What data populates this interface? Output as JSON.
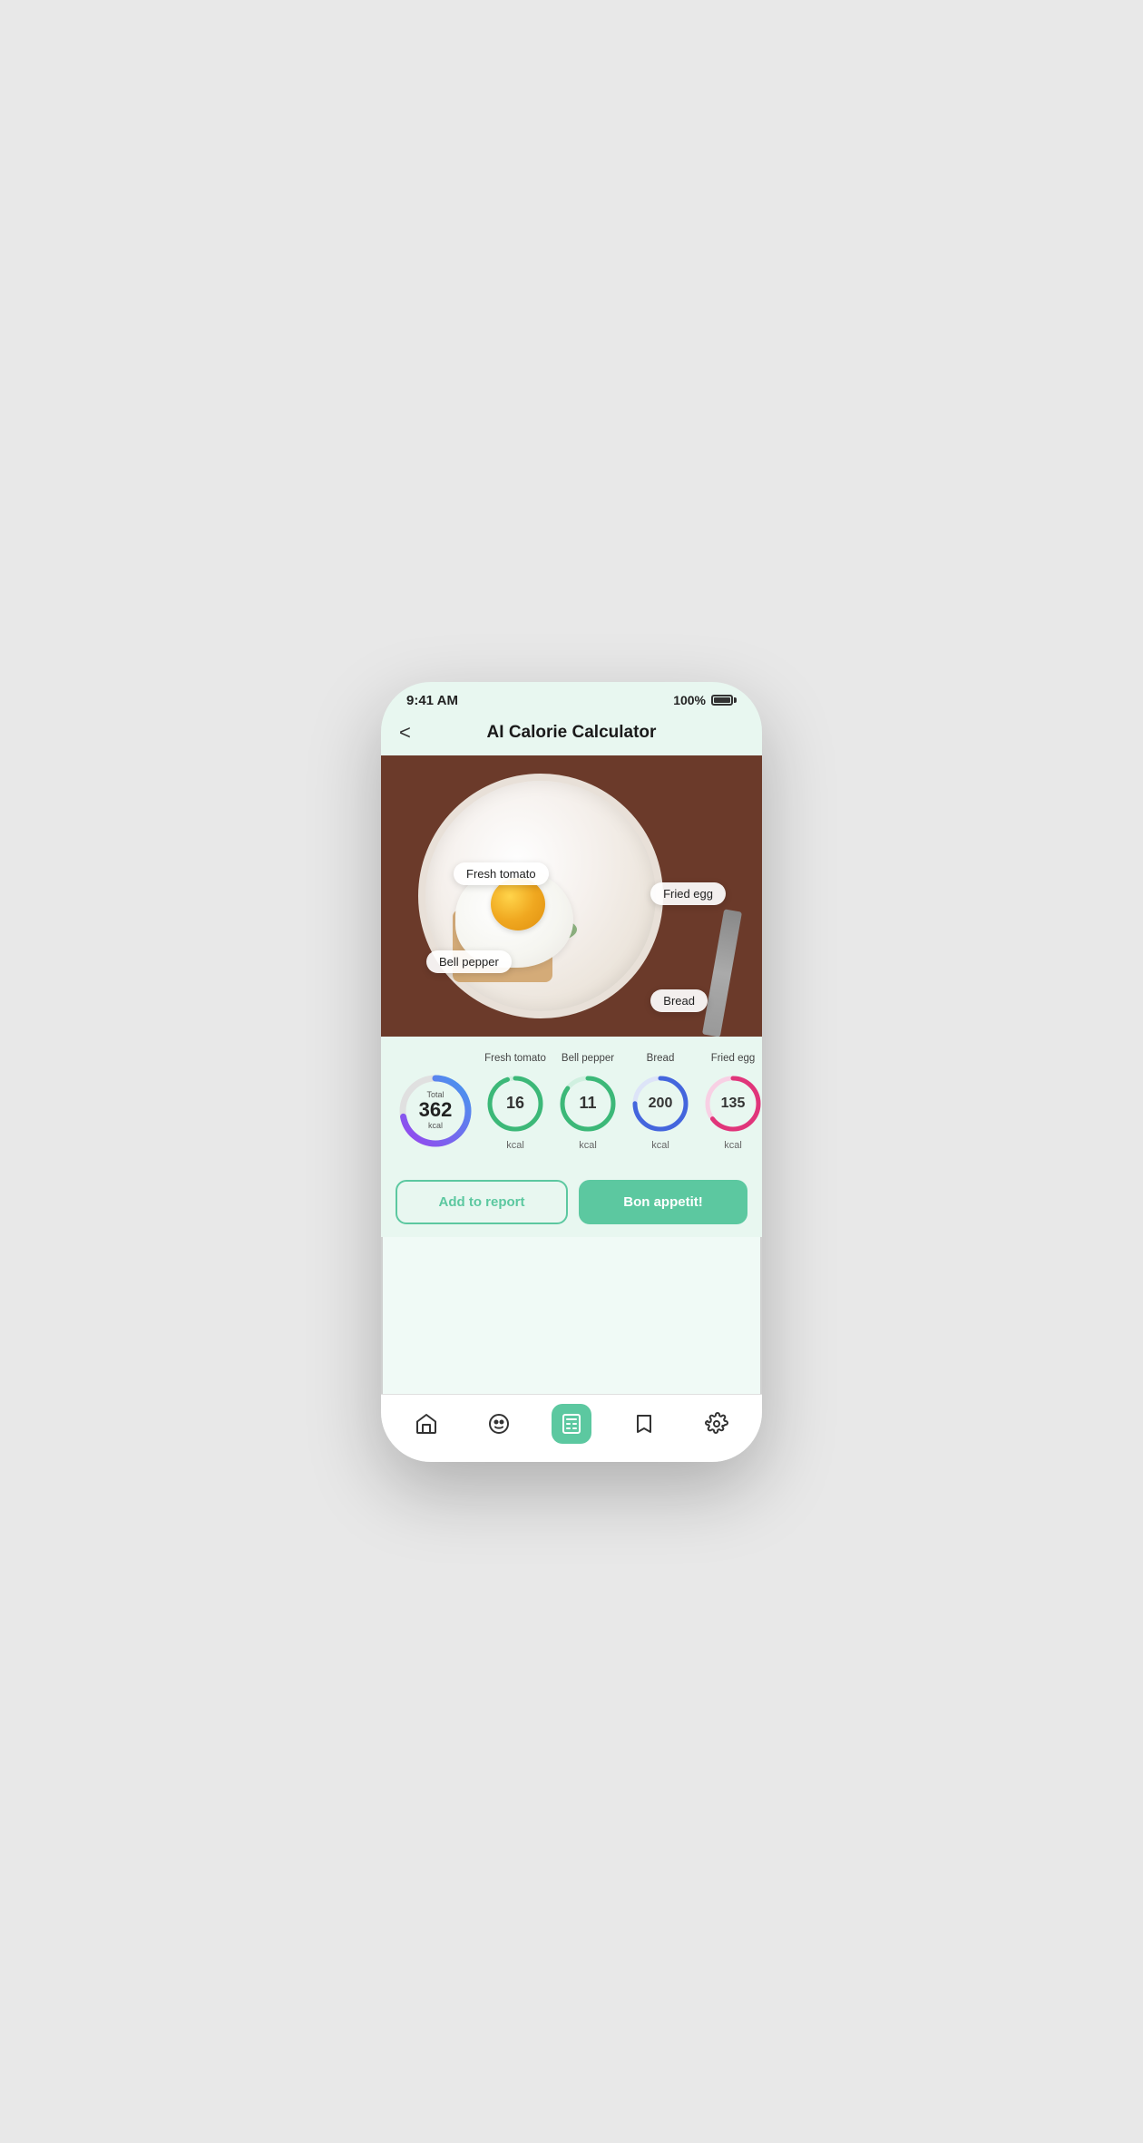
{
  "status": {
    "time": "9:41 AM",
    "battery": "100%"
  },
  "header": {
    "title": "AI Calorie Calculator",
    "back_label": "<"
  },
  "food_labels": {
    "fresh_tomato": "Fresh tomato",
    "fried_egg": "Fried egg",
    "bell_pepper": "Bell pepper",
    "bread": "Bread"
  },
  "calories": {
    "total_label": "Total",
    "total_value": "362",
    "total_unit": "kcal",
    "items": [
      {
        "name": "Fresh tomato",
        "value": "16",
        "unit": "kcal",
        "color": "#3cb878",
        "pct": 0.95,
        "track": "#d0f0e0"
      },
      {
        "name": "Bell pepper",
        "value": "11",
        "unit": "kcal",
        "color": "#3cb878",
        "pct": 0.85,
        "track": "#d0f0e0"
      },
      {
        "name": "Bread",
        "value": "200",
        "unit": "kcal",
        "color": "#4466dd",
        "pct": 0.75,
        "track": "#dde4f8"
      },
      {
        "name": "Fried egg",
        "value": "135",
        "unit": "kcal",
        "color": "#e0357a",
        "pct": 0.65,
        "track": "#f8d0e4"
      }
    ]
  },
  "buttons": {
    "add_report": "Add to report",
    "bon_appetit": "Bon appetit!"
  },
  "nav": {
    "items": [
      {
        "id": "home",
        "label": "Home",
        "icon": "home-icon",
        "active": false
      },
      {
        "id": "profile",
        "label": "Profile",
        "icon": "face-icon",
        "active": false
      },
      {
        "id": "calculator",
        "label": "Calculator",
        "icon": "calculator-icon",
        "active": true
      },
      {
        "id": "bookmark",
        "label": "Bookmark",
        "icon": "bookmark-icon",
        "active": false
      },
      {
        "id": "settings",
        "label": "Settings",
        "icon": "settings-icon",
        "active": false
      }
    ]
  },
  "total_ring": {
    "color_start": "#9944ee",
    "color_end": "#4499ee",
    "track": "#e0e0e0",
    "pct": 0.72
  }
}
